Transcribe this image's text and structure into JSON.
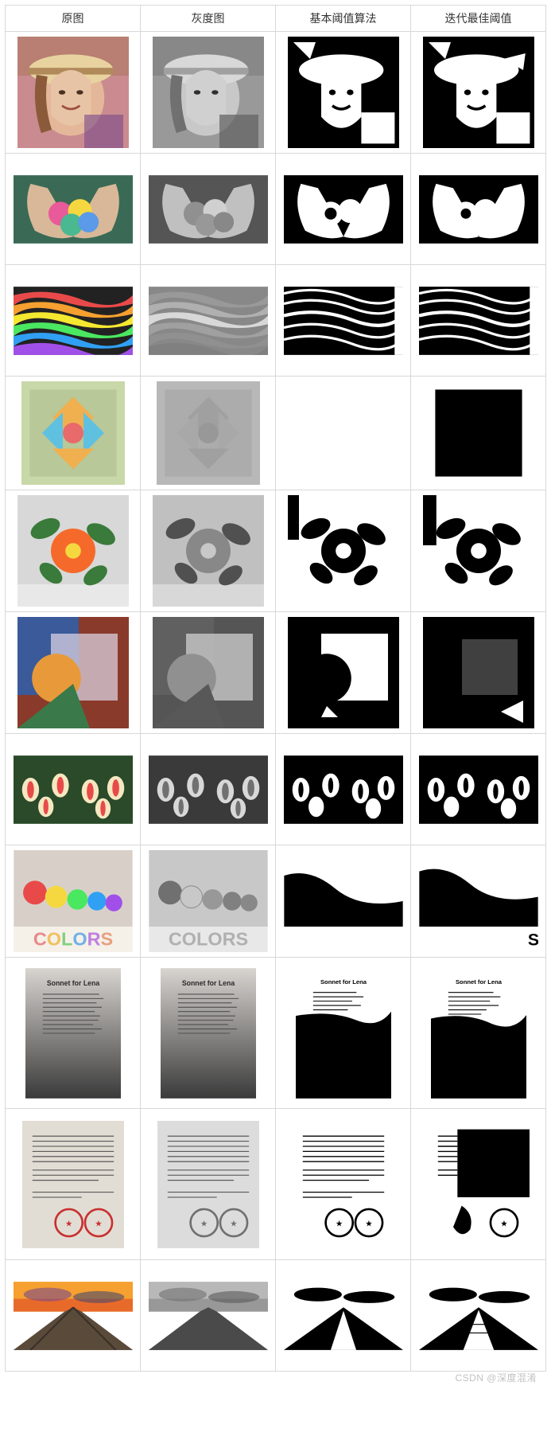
{
  "headers": [
    "原图",
    "灰度图",
    "基本阈值算法",
    "迭代最佳阈值"
  ],
  "rows": [
    {
      "name": "lena-portrait",
      "kind": "portrait"
    },
    {
      "name": "macarons-hands",
      "kind": "macarons"
    },
    {
      "name": "rainbow-waves",
      "kind": "waves"
    },
    {
      "name": "geometric-tiles",
      "kind": "tiles"
    },
    {
      "name": "orange-flower",
      "kind": "flower"
    },
    {
      "name": "abstract-shapes",
      "kind": "abstract"
    },
    {
      "name": "tulips-field",
      "kind": "tulips"
    },
    {
      "name": "colors-balls",
      "kind": "colors"
    },
    {
      "name": "sonnet-lena",
      "kind": "sonnet"
    },
    {
      "name": "chinese-document",
      "kind": "doc"
    },
    {
      "name": "great-wall-sunset",
      "kind": "wall"
    }
  ],
  "row_labels": {
    "colors_text": "COLORS",
    "sonnet_title": "Sonnet for Lena"
  },
  "watermark": "CSDN @深度混淆"
}
